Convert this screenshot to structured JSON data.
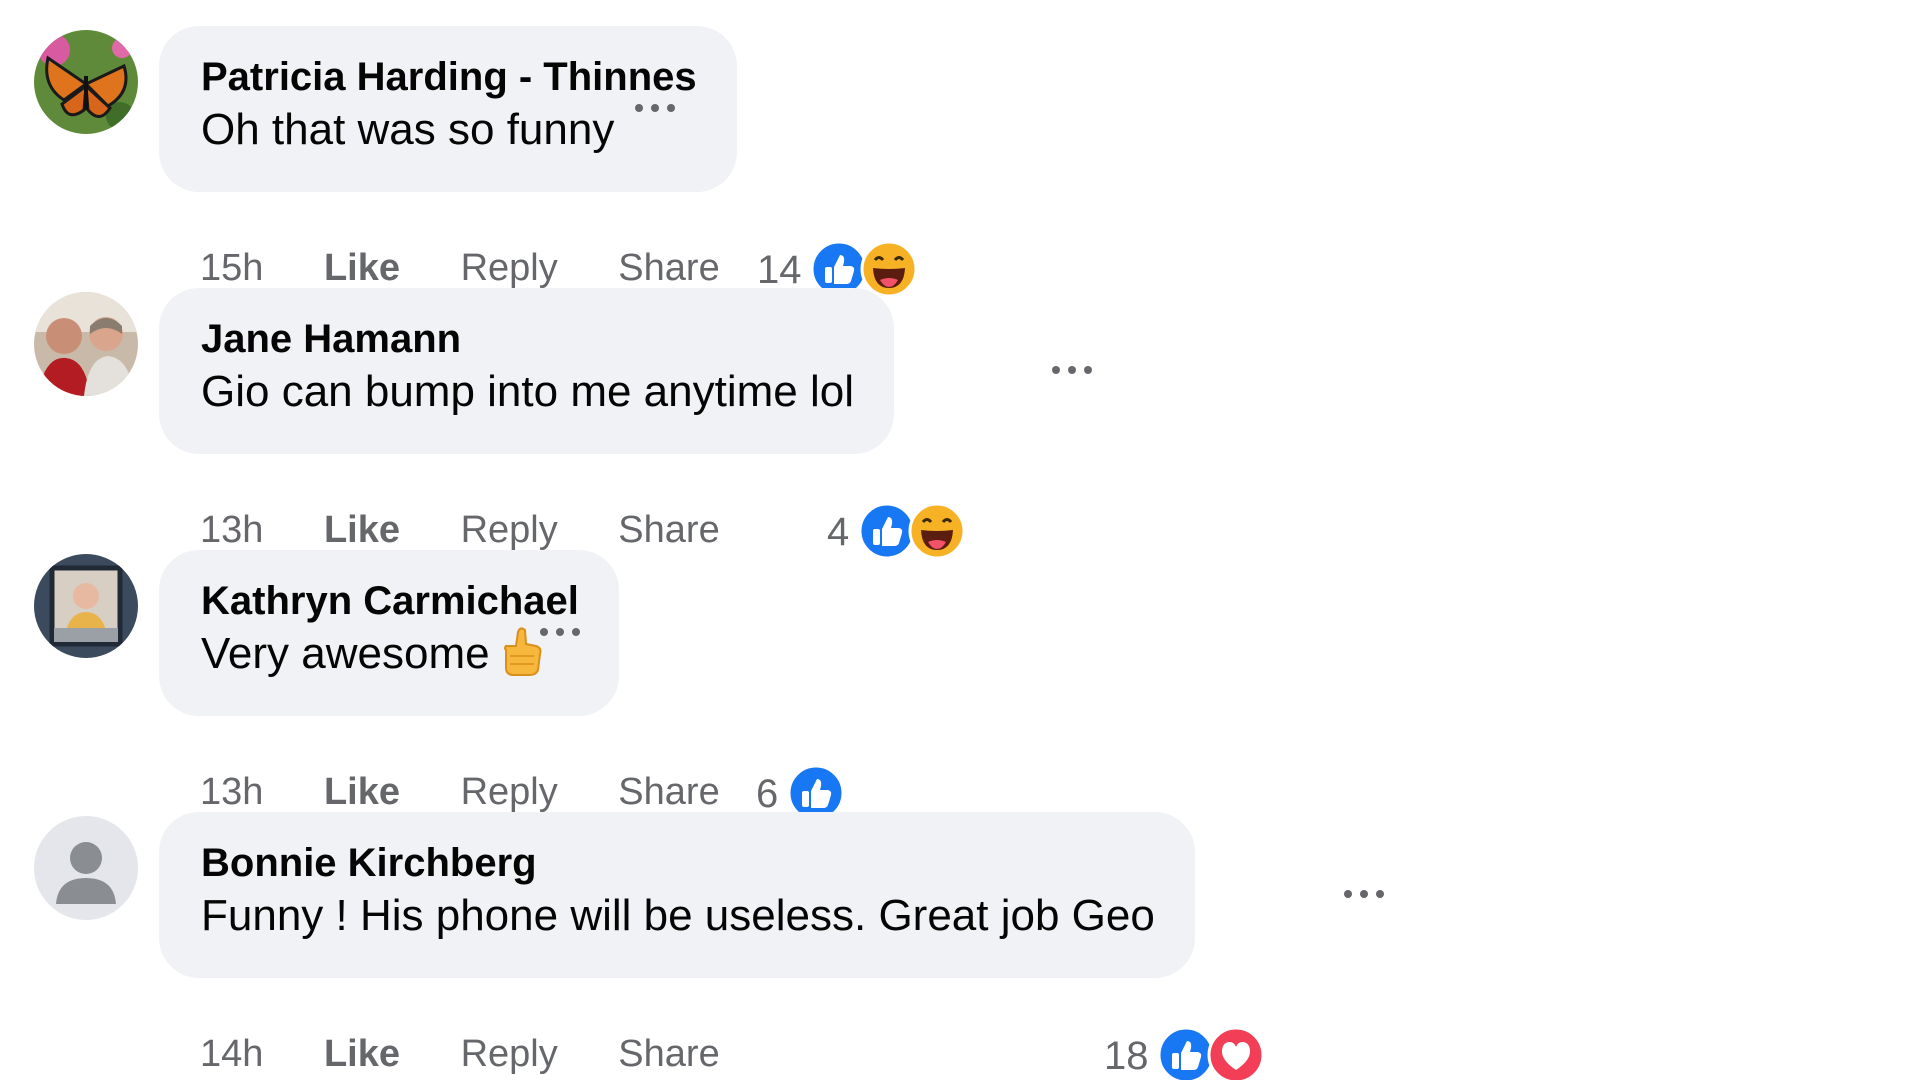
{
  "comments": [
    {
      "author": "Patricia Harding - Thinnes",
      "text": "Oh that was so funny",
      "time": "15h",
      "like_label": "Like",
      "reply_label": "Reply",
      "share_label": "Share",
      "reaction_count": "14",
      "reactions": [
        "like-icon",
        "haha-icon"
      ],
      "avatar": "butterfly-photo"
    },
    {
      "author": "Jane Hamann",
      "text": "Gio can bump into me anytime lol",
      "time": "13h",
      "like_label": "Like",
      "reply_label": "Reply",
      "share_label": "Share",
      "reaction_count": "4",
      "reactions": [
        "like-icon",
        "haha-icon"
      ],
      "avatar": "people-photo"
    },
    {
      "author": "Kathryn Carmichael",
      "text": "Very awesome",
      "emoji": "thumbs-up-emoji",
      "time": "13h",
      "like_label": "Like",
      "reply_label": "Reply",
      "share_label": "Share",
      "reaction_count": "6",
      "reactions": [
        "like-icon"
      ],
      "avatar": "framed-photo"
    },
    {
      "author": "Bonnie Kirchberg",
      "text": "Funny ! His phone will be useless. Great job Geo",
      "time": "14h",
      "like_label": "Like",
      "reply_label": "Reply",
      "share_label": "Share",
      "reaction_count": "18",
      "reactions": [
        "like-icon",
        "love-icon"
      ],
      "avatar": "default-silhouette"
    }
  ],
  "colors": {
    "bubble": "#f0f2f5",
    "secondary_text": "#65676b",
    "like_blue": "#1877f2",
    "love_red": "#f33e58",
    "haha_yellow": "#f7b125"
  }
}
